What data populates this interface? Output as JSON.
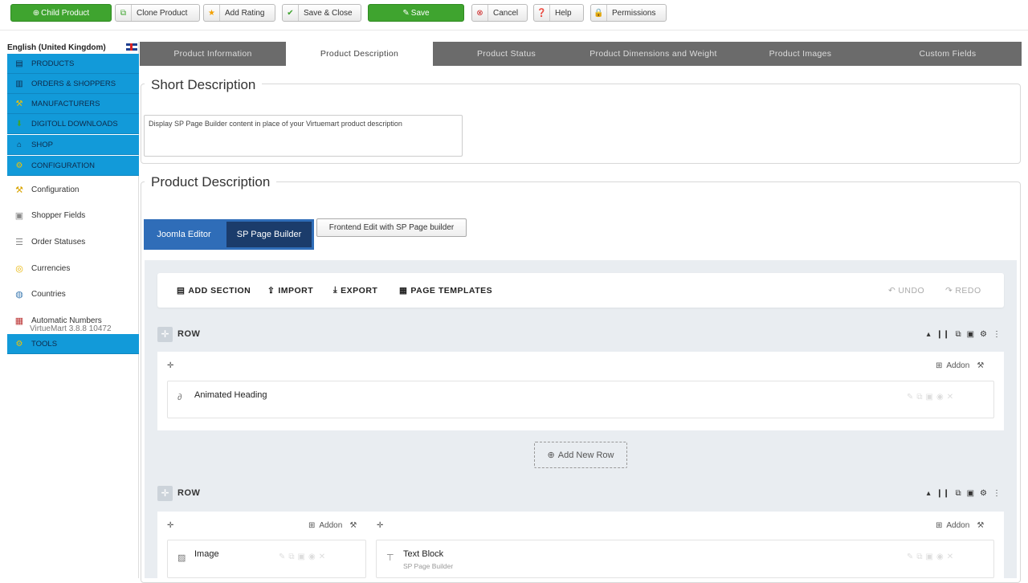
{
  "toolbar": {
    "child_product": "Child Product",
    "clone_product": "Clone Product",
    "add_rating": "Add Rating",
    "save_close": "Save & Close",
    "save": "Save",
    "cancel": "Cancel",
    "help": "Help",
    "permissions": "Permissions"
  },
  "sidebar": {
    "language": "English (United Kingdom)",
    "sections": [
      {
        "label": "PRODUCTS",
        "icon": "products-icon"
      },
      {
        "label": "ORDERS & SHOPPERS",
        "icon": "orders-icon"
      },
      {
        "label": "MANUFACTURERS",
        "icon": "manufacturers-icon"
      },
      {
        "label": "DIGITOLL DOWNLOADS",
        "icon": "downloads-icon"
      },
      {
        "label": "SHOP",
        "icon": "shop-icon"
      },
      {
        "label": "CONFIGURATION",
        "icon": "configuration-icon"
      }
    ],
    "items": [
      {
        "label": "Configuration"
      },
      {
        "label": "Shopper Fields"
      },
      {
        "label": "Order Statuses"
      },
      {
        "label": "Currencies"
      },
      {
        "label": "Countries"
      },
      {
        "label": "Automatic Numbers"
      }
    ],
    "tools": "TOOLS",
    "version": "VirtueMart 3.8.8 10472"
  },
  "tabs": [
    {
      "label": "Product Information"
    },
    {
      "label": "Product Description"
    },
    {
      "label": "Product Status"
    },
    {
      "label": "Product Dimensions and Weight"
    },
    {
      "label": "Product Images"
    },
    {
      "label": "Custom Fields"
    }
  ],
  "short_description": {
    "legend": "Short Description",
    "value": "Display SP Page Builder content in place of your Virtuemart product description"
  },
  "product_description": {
    "legend": "Product Description",
    "editor_tabs": [
      "Joomla Editor",
      "SP Page Builder"
    ],
    "frontend_edit": "Frontend Edit with SP Page builder"
  },
  "builder": {
    "add_section": "ADD SECTION",
    "import": "IMPORT",
    "export": "EXPORT",
    "page_templates": "PAGE TEMPLATES",
    "undo": "UNDO",
    "redo": "REDO",
    "row_label": "ROW",
    "addon_label": "Addon",
    "add_new_row": "Add New Row",
    "rows": [
      {
        "addons": [
          {
            "title": "Animated Heading"
          }
        ]
      },
      {
        "addons": [
          {
            "title": "Image"
          },
          {
            "title": "Text Block",
            "subtitle": "SP Page Builder"
          }
        ]
      }
    ]
  },
  "colors": {
    "accent_blue": "#129ad9",
    "save_green": "#3fa42f",
    "tab_bar": "#6b6b6b",
    "editor_active": "#1b3c6b",
    "editor_tab": "#2f6db8"
  }
}
